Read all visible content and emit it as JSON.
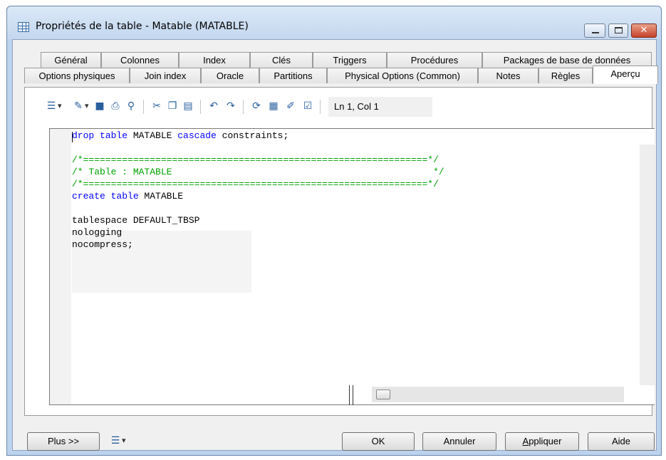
{
  "window": {
    "title": "Propriétés de la table - Matable (MATABLE)",
    "icon": "table-icon"
  },
  "tabs_row1": [
    "Général",
    "Colonnes",
    "Index",
    "Clés",
    "Triggers",
    "Procédures",
    "Packages de base de données"
  ],
  "tabs_row2": [
    "Options physiques",
    "Join index",
    "Oracle",
    "Partitions",
    "Physical Options (Common)",
    "Notes",
    "Règles",
    "Aperçu"
  ],
  "active_tab": "Aperçu",
  "toolbar": {
    "position": "Ln 1, Col 1",
    "icons": [
      "script-icon",
      "edit-icon",
      "save-icon",
      "print-icon",
      "find-icon",
      "cut-icon",
      "copy-icon",
      "paste-icon",
      "undo-icon",
      "redo-icon",
      "refresh-icon",
      "list-icon",
      "edit-props-icon",
      "check-icon"
    ]
  },
  "code": {
    "line1_kw1": "drop table",
    "line1_plain1": " MATABLE ",
    "line1_kw2": "cascade",
    "line1_plain2": " constraints;",
    "comment1": "/*==============================================================*/",
    "comment2": "/* Table : MATABLE                                               */",
    "comment3": "/*==============================================================*/",
    "create_kw": "create table",
    "create_name": " MATABLE",
    "ts": "tablespace DEFAULT_TBSP",
    "nologging": "nologging",
    "nocompress": "nocompress;"
  },
  "buttons": {
    "plus": "Plus >>",
    "ok": "OK",
    "cancel": "Annuler",
    "apply_underlined": "A",
    "apply_rest": "ppliquer",
    "help": "Aide"
  }
}
